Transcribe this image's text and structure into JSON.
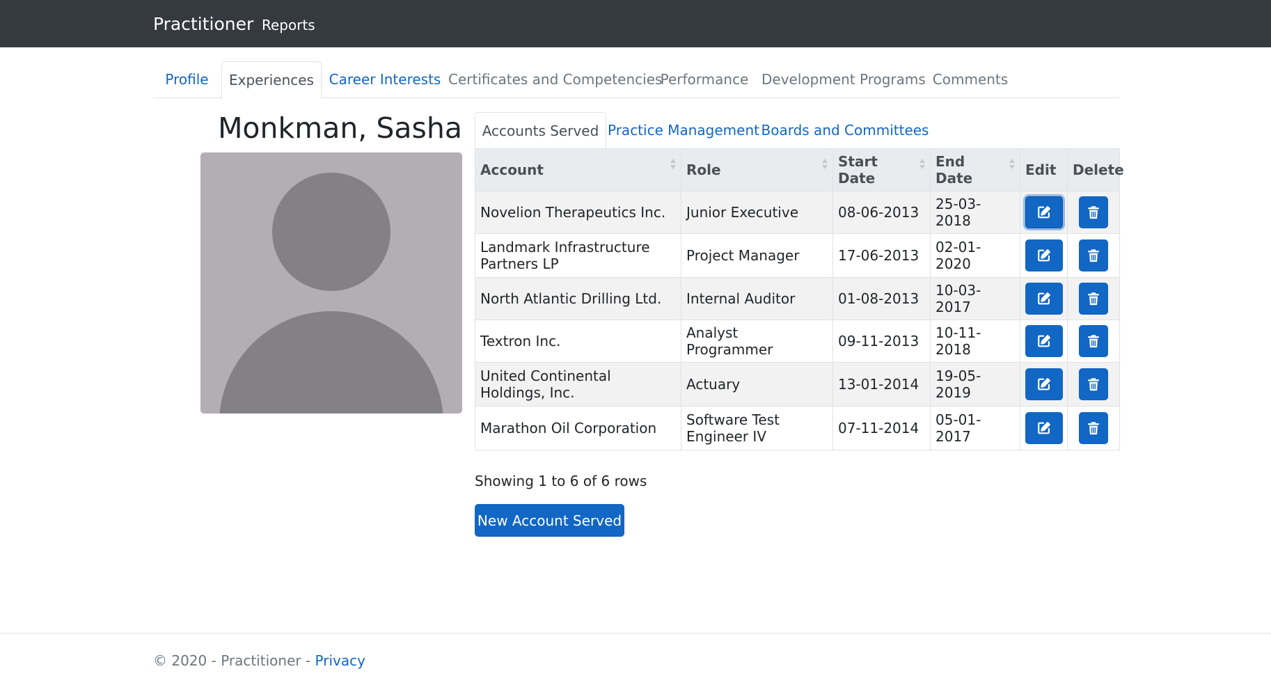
{
  "navbar": {
    "brand": "Practitioner",
    "links": [
      "Reports"
    ]
  },
  "main_tabs": [
    {
      "label": "Profile",
      "state": "link"
    },
    {
      "label": "Experiences",
      "state": "active"
    },
    {
      "label": "Career Interests",
      "state": "link"
    },
    {
      "label": "Certificates and Competencies",
      "state": "muted"
    },
    {
      "label": "Performance",
      "state": "muted"
    },
    {
      "label": "Development Programs",
      "state": "muted"
    },
    {
      "label": "Comments",
      "state": "muted"
    }
  ],
  "person": {
    "name": "Monkman, Sasha"
  },
  "sub_tabs": [
    {
      "label": "Accounts Served",
      "state": "active"
    },
    {
      "label": "Practice Management",
      "state": "link"
    },
    {
      "label": "Boards and Committees",
      "state": "link"
    }
  ],
  "table": {
    "columns": [
      "Account",
      "Role",
      "Start Date",
      "End Date",
      "Edit",
      "Delete"
    ],
    "rows": [
      {
        "account": "Novelion Therapeutics Inc.",
        "role": "Junior Executive",
        "start": "08-06-2013",
        "end": "25-03-2018"
      },
      {
        "account": "Landmark Infrastructure Partners LP",
        "role": "Project Manager",
        "start": "17-06-2013",
        "end": "02-01-2020"
      },
      {
        "account": "North Atlantic Drilling Ltd.",
        "role": "Internal Auditor",
        "start": "01-08-2013",
        "end": "10-03-2017"
      },
      {
        "account": "Textron Inc.",
        "role": "Analyst Programmer",
        "start": "09-11-2013",
        "end": "10-11-2018"
      },
      {
        "account": "United Continental Holdings, Inc.",
        "role": "Actuary",
        "start": "13-01-2014",
        "end": "19-05-2019"
      },
      {
        "account": "Marathon Oil Corporation",
        "role": "Software Test Engineer IV",
        "start": "07-11-2014",
        "end": "05-01-2017"
      }
    ],
    "edit_icon": "edit-icon",
    "delete_icon": "trash-icon"
  },
  "pagination_text": "Showing 1 to 6 of 6 rows",
  "new_button_label": "New Account Served",
  "footer": {
    "text": "© 2020 - Practitioner - ",
    "privacy_label": "Privacy"
  },
  "colors": {
    "navbar": "#343a40",
    "primary": "#1266c4",
    "avatar_bg": "#b2aeb3",
    "avatar_fg": "#838186"
  }
}
